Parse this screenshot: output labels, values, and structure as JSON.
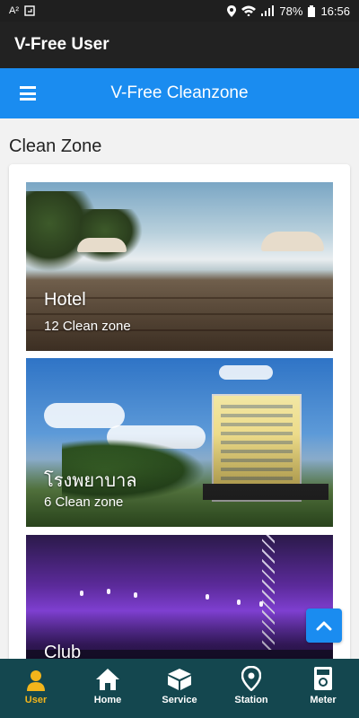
{
  "status_bar": {
    "left_icons": [
      "text-size-icon",
      "screenshot-icon"
    ],
    "left_text": "A²",
    "battery": "78%",
    "time": "16:56"
  },
  "app_bar": {
    "title": "V-Free User"
  },
  "sub_bar": {
    "title": "V-Free Cleanzone",
    "menu_icon": "hamburger-icon"
  },
  "section": {
    "heading": "Clean Zone"
  },
  "zones": [
    {
      "name": "Hotel",
      "count": "12 Clean zone"
    },
    {
      "name": "โรงพยาบาล",
      "count": "6 Clean zone"
    },
    {
      "name": "Club",
      "count": ""
    }
  ],
  "scroll_top": {
    "icon": "chevron-up-icon"
  },
  "bottom_nav": {
    "items": [
      {
        "label": "User",
        "icon": "user-icon",
        "active": true
      },
      {
        "label": "Home",
        "icon": "home-icon",
        "active": false
      },
      {
        "label": "Service",
        "icon": "box-icon",
        "active": false
      },
      {
        "label": "Station",
        "icon": "location-pin-icon",
        "active": false
      },
      {
        "label": "Meter",
        "icon": "meter-icon",
        "active": false
      }
    ]
  },
  "colors": {
    "primary": "#1a8cf0",
    "app_bar": "#222222",
    "bottom_nav": "#14474f",
    "active_nav": "#f3b51b"
  }
}
